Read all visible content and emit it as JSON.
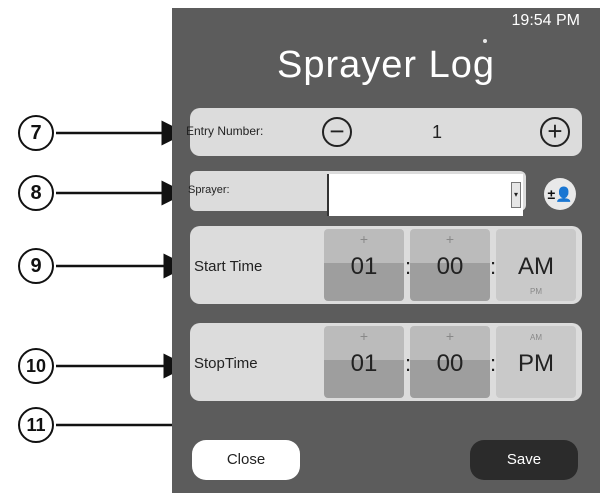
{
  "status": {
    "time": "19:54 PM"
  },
  "title": "Sprayer Log",
  "entry": {
    "label": "Entry Number:",
    "minus_glyph": "−",
    "value": "1",
    "plus_glyph": "+"
  },
  "sprayer": {
    "label": "Sprayer:",
    "value": "",
    "dropdown_glyph": "▾",
    "person_button_glyph": "±👤",
    "person_icon": "person-plus-minus-icon"
  },
  "start_time": {
    "label": "Start Time",
    "plus": "+",
    "hour": "01",
    "minute": "00",
    "ampm": "AM",
    "ampm_alt": "PM",
    "sep": ":"
  },
  "stop_time": {
    "label": "StopTime",
    "plus": "+",
    "hour": "01",
    "minute": "00",
    "ampm": "PM",
    "ampm_alt": "AM",
    "sep": ":"
  },
  "footer": {
    "close_label": "Close",
    "save_label": "Save"
  },
  "callouts": [
    "7",
    "8",
    "9",
    "10",
    "11"
  ],
  "colors": {
    "background": "#5c5c5c",
    "panel": "#dcdcdc",
    "save_button": "#2b2b2b",
    "close_button": "#ffffff"
  }
}
